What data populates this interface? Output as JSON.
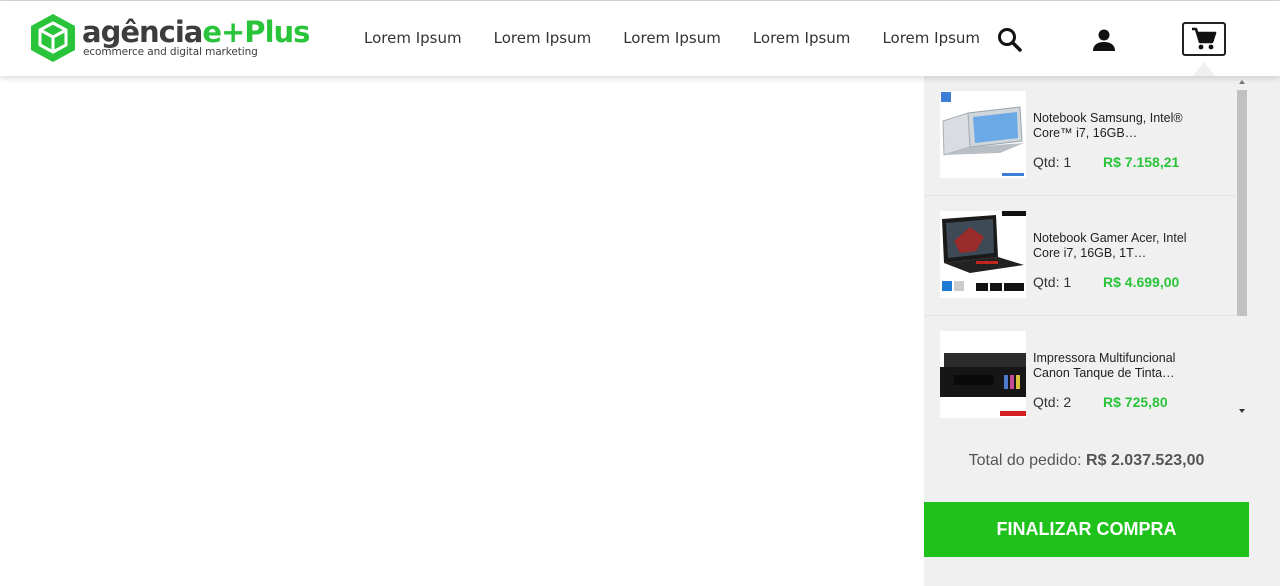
{
  "brand": {
    "name_main": "agência",
    "name_accent": "e+Plus",
    "tagline": "ecommerce and digital marketing",
    "accent_color": "#2ac43b"
  },
  "nav": {
    "items": [
      {
        "label": "Lorem Ipsum"
      },
      {
        "label": "Lorem Ipsum"
      },
      {
        "label": "Lorem Ipsum"
      },
      {
        "label": "Lorem Ipsum"
      },
      {
        "label": "Lorem Ipsum"
      }
    ]
  },
  "header_icons": [
    "search-icon",
    "user-icon",
    "cart-icon"
  ],
  "cart": {
    "items": [
      {
        "name": "Notebook Samsung, Intel® Core™ i7, 16GB…",
        "qty_label": "Qtd: 1",
        "price": "R$ 7.158,21",
        "image": "laptop-silver"
      },
      {
        "name": "Notebook Gamer Acer, Intel Core i7, 16GB, 1T…",
        "qty_label": "Qtd: 1",
        "price": "R$ 4.699,00",
        "image": "laptop-gamer"
      },
      {
        "name": "Impressora Multifuncional Canon Tanque de Tinta…",
        "qty_label": "Qtd: 2",
        "price": "R$ 725,80",
        "image": "printer"
      }
    ],
    "total_label": "Total do pedido:",
    "total_value": "R$ 2.037.523,00",
    "checkout_label": "FINALIZAR COMPRA",
    "checkout_color": "#1ec21a"
  }
}
